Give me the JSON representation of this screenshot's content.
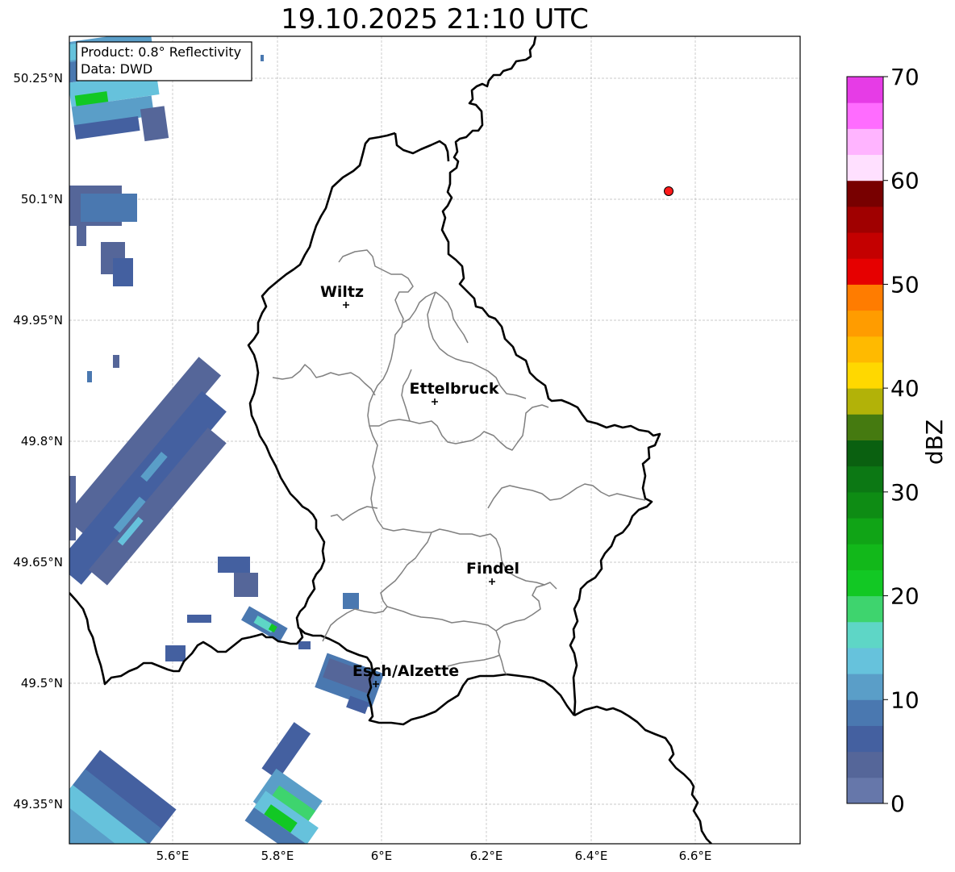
{
  "title": "19.10.2025 21:10 UTC",
  "info_box": {
    "product": "Product: 0.8° Reflectivity",
    "data": "Data: DWD"
  },
  "lat_ticks": [
    "50.25°N",
    "50.1°N",
    "49.95°N",
    "49.8°N",
    "49.65°N",
    "49.5°N",
    "49.35°N"
  ],
  "lon_ticks": [
    "5.6°E",
    "5.8°E",
    "6°E",
    "6.2°E",
    "6.4°E",
    "6.6°E"
  ],
  "cities": [
    {
      "name": "Wiltz"
    },
    {
      "name": "Ettelbruck"
    },
    {
      "name": "Findel"
    },
    {
      "name": "Esch/Alzette"
    }
  ],
  "colorbar": {
    "label": "dBZ",
    "ticks": [
      "0",
      "10",
      "20",
      "30",
      "40",
      "50",
      "60",
      "70"
    ],
    "colors": [
      "#6677aa",
      "#556699",
      "#4460a0",
      "#4a78b0",
      "#5a9ec8",
      "#66c2dc",
      "#5ed6c6",
      "#3ed46e",
      "#12c824",
      "#12b81a",
      "#10a416",
      "#0e8c14",
      "#0c7814",
      "#0a6010",
      "#457a10",
      "#b2b208",
      "#ffd800",
      "#ffba00",
      "#ff9c00",
      "#ff7c00",
      "#e60000",
      "#c40000",
      "#a00000",
      "#780000",
      "#ffe0ff",
      "#ffb4ff",
      "#ff6cff",
      "#e63ce6"
    ]
  },
  "point_marker": {
    "color": "#ff1a1a"
  }
}
